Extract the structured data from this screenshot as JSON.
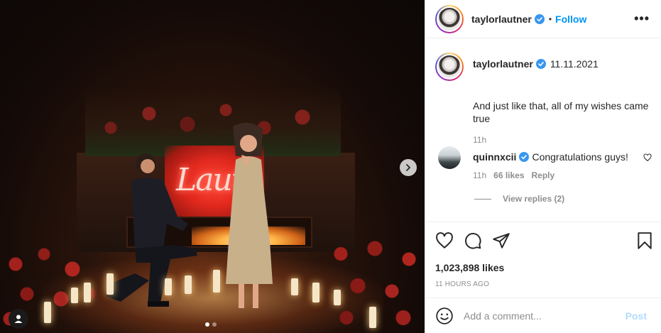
{
  "photo": {
    "neon_sign": "Lauth",
    "carousel_dots": 2,
    "active_dot": 0
  },
  "header": {
    "username": "taylorlautner",
    "separator": "•",
    "follow_label": "Follow",
    "more_label": "•••"
  },
  "caption": {
    "username": "taylorlautner",
    "date": "11.11.2021",
    "text": "And just like that, all of my wishes came true",
    "time": "11h"
  },
  "comment": {
    "username": "quinnxcii",
    "text": "Congratulations guys!",
    "time": "11h",
    "likes": "66 likes",
    "reply_label": "Reply",
    "view_replies": "View replies (2)"
  },
  "post": {
    "likes": "1,023,898 likes",
    "time_ago": "11 HOURS AGO"
  },
  "add_comment": {
    "placeholder": "Add a comment...",
    "post_label": "Post"
  },
  "colors": {
    "accent": "#0095f6",
    "post_disabled": "#b3dbff",
    "muted": "#8e8e8e",
    "text": "#262626"
  }
}
